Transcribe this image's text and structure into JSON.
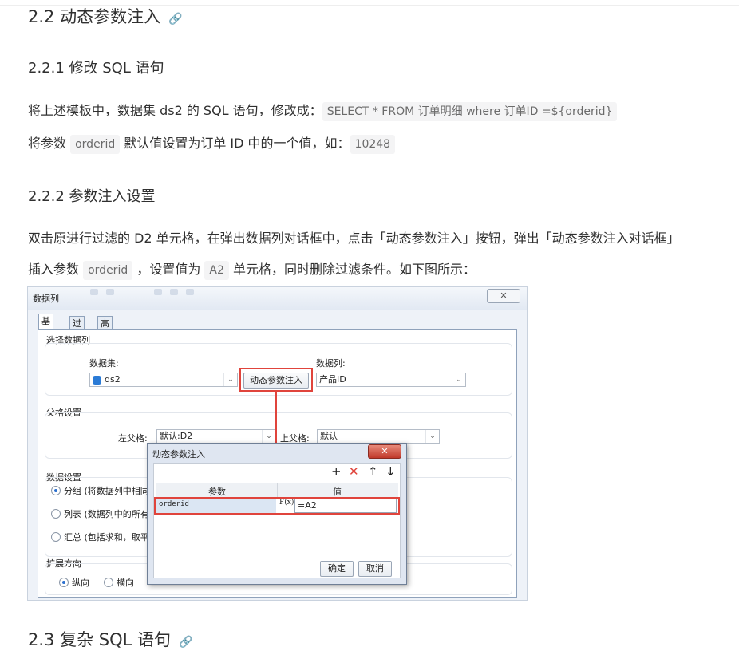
{
  "h_2_2": "2.2 动态参数注入",
  "h_2_2_1": "2.2.1 修改 SQL 语句",
  "p1_text": "将上述模板中，数据集 ds2 的 SQL 语句，修改成：",
  "p1_code": "SELECT * FROM 订单明细 where 订单ID =${orderid}",
  "p2_prefix": "将参数",
  "p2_code1": "orderid",
  "p2_mid": "默认值设置为订单 ID 中的一个值，如：",
  "p2_code2": "10248",
  "h_2_2_2": "2.2.2 参数注入设置",
  "p3_text": "双击原进行过滤的 D2 单元格，在弹出数据列对话框中，点击「动态参数注入」按钮，弹出「动态参数注入对话框」",
  "p4_prefix": "插入参数",
  "p4_code1": "orderid",
  "p4_mid": "，设置值为",
  "p4_code2": "A2",
  "p4_suffix": "单元格，同时删除过滤条件。如下图所示：",
  "h_2_3": "2.3 复杂 SQL 语句",
  "anchor_icon": "link-icon",
  "highlight_color": "#e0443c",
  "screenshot": {
    "title": "数据列",
    "close": "✕",
    "tabs": [
      "基本",
      "过滤",
      "高级"
    ],
    "select_group": "选择数据列",
    "dataset_label": "数据集:",
    "dataset_value": "ds2",
    "column_label": "数据列:",
    "column_value": "产品ID",
    "inject_button": "动态参数注入",
    "parent_group": "父格设置",
    "left_parent_label": "左父格:",
    "left_parent_value": "默认:D2",
    "top_parent_label": "上父格:",
    "top_parent_value": "默认",
    "data_group": "数据设置",
    "radio_group": "分组 (将数据列中相同",
    "radio_list": "列表 (数据列中的所有",
    "radio_summary": "汇总 (包括求和，取平",
    "expand_group": "扩展方向",
    "expand_vertical": "纵向",
    "expand_horizontal": "横向",
    "dialog": {
      "title": "动态参数注入",
      "close": "✕",
      "col_param": "参数",
      "col_value": "值",
      "param_name": "orderid",
      "fx": "F(x)",
      "param_value": "=A2",
      "ok": "确定",
      "cancel": "取消"
    }
  }
}
